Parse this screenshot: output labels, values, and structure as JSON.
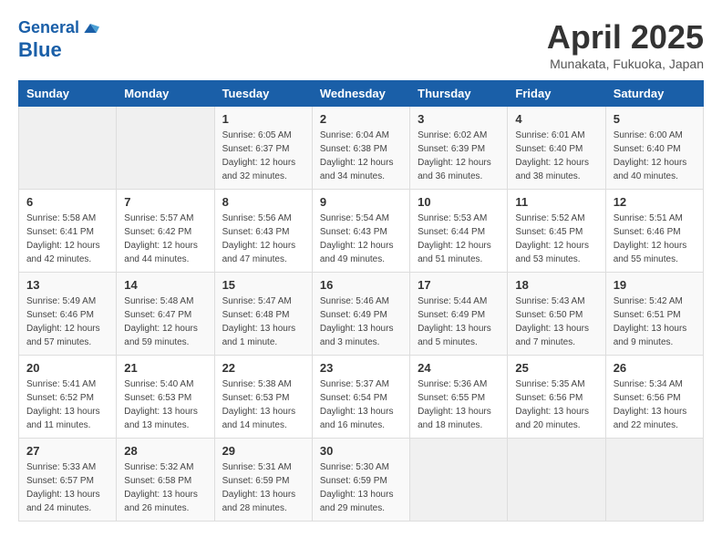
{
  "header": {
    "logo_line1": "General",
    "logo_line2": "Blue",
    "month": "April 2025",
    "location": "Munakata, Fukuoka, Japan"
  },
  "weekdays": [
    "Sunday",
    "Monday",
    "Tuesday",
    "Wednesday",
    "Thursday",
    "Friday",
    "Saturday"
  ],
  "weeks": [
    [
      {
        "day": "",
        "info": ""
      },
      {
        "day": "",
        "info": ""
      },
      {
        "day": "1",
        "sunrise": "Sunrise: 6:05 AM",
        "sunset": "Sunset: 6:37 PM",
        "daylight": "Daylight: 12 hours and 32 minutes."
      },
      {
        "day": "2",
        "sunrise": "Sunrise: 6:04 AM",
        "sunset": "Sunset: 6:38 PM",
        "daylight": "Daylight: 12 hours and 34 minutes."
      },
      {
        "day": "3",
        "sunrise": "Sunrise: 6:02 AM",
        "sunset": "Sunset: 6:39 PM",
        "daylight": "Daylight: 12 hours and 36 minutes."
      },
      {
        "day": "4",
        "sunrise": "Sunrise: 6:01 AM",
        "sunset": "Sunset: 6:40 PM",
        "daylight": "Daylight: 12 hours and 38 minutes."
      },
      {
        "day": "5",
        "sunrise": "Sunrise: 6:00 AM",
        "sunset": "Sunset: 6:40 PM",
        "daylight": "Daylight: 12 hours and 40 minutes."
      }
    ],
    [
      {
        "day": "6",
        "sunrise": "Sunrise: 5:58 AM",
        "sunset": "Sunset: 6:41 PM",
        "daylight": "Daylight: 12 hours and 42 minutes."
      },
      {
        "day": "7",
        "sunrise": "Sunrise: 5:57 AM",
        "sunset": "Sunset: 6:42 PM",
        "daylight": "Daylight: 12 hours and 44 minutes."
      },
      {
        "day": "8",
        "sunrise": "Sunrise: 5:56 AM",
        "sunset": "Sunset: 6:43 PM",
        "daylight": "Daylight: 12 hours and 47 minutes."
      },
      {
        "day": "9",
        "sunrise": "Sunrise: 5:54 AM",
        "sunset": "Sunset: 6:43 PM",
        "daylight": "Daylight: 12 hours and 49 minutes."
      },
      {
        "day": "10",
        "sunrise": "Sunrise: 5:53 AM",
        "sunset": "Sunset: 6:44 PM",
        "daylight": "Daylight: 12 hours and 51 minutes."
      },
      {
        "day": "11",
        "sunrise": "Sunrise: 5:52 AM",
        "sunset": "Sunset: 6:45 PM",
        "daylight": "Daylight: 12 hours and 53 minutes."
      },
      {
        "day": "12",
        "sunrise": "Sunrise: 5:51 AM",
        "sunset": "Sunset: 6:46 PM",
        "daylight": "Daylight: 12 hours and 55 minutes."
      }
    ],
    [
      {
        "day": "13",
        "sunrise": "Sunrise: 5:49 AM",
        "sunset": "Sunset: 6:46 PM",
        "daylight": "Daylight: 12 hours and 57 minutes."
      },
      {
        "day": "14",
        "sunrise": "Sunrise: 5:48 AM",
        "sunset": "Sunset: 6:47 PM",
        "daylight": "Daylight: 12 hours and 59 minutes."
      },
      {
        "day": "15",
        "sunrise": "Sunrise: 5:47 AM",
        "sunset": "Sunset: 6:48 PM",
        "daylight": "Daylight: 13 hours and 1 minute."
      },
      {
        "day": "16",
        "sunrise": "Sunrise: 5:46 AM",
        "sunset": "Sunset: 6:49 PM",
        "daylight": "Daylight: 13 hours and 3 minutes."
      },
      {
        "day": "17",
        "sunrise": "Sunrise: 5:44 AM",
        "sunset": "Sunset: 6:49 PM",
        "daylight": "Daylight: 13 hours and 5 minutes."
      },
      {
        "day": "18",
        "sunrise": "Sunrise: 5:43 AM",
        "sunset": "Sunset: 6:50 PM",
        "daylight": "Daylight: 13 hours and 7 minutes."
      },
      {
        "day": "19",
        "sunrise": "Sunrise: 5:42 AM",
        "sunset": "Sunset: 6:51 PM",
        "daylight": "Daylight: 13 hours and 9 minutes."
      }
    ],
    [
      {
        "day": "20",
        "sunrise": "Sunrise: 5:41 AM",
        "sunset": "Sunset: 6:52 PM",
        "daylight": "Daylight: 13 hours and 11 minutes."
      },
      {
        "day": "21",
        "sunrise": "Sunrise: 5:40 AM",
        "sunset": "Sunset: 6:53 PM",
        "daylight": "Daylight: 13 hours and 13 minutes."
      },
      {
        "day": "22",
        "sunrise": "Sunrise: 5:38 AM",
        "sunset": "Sunset: 6:53 PM",
        "daylight": "Daylight: 13 hours and 14 minutes."
      },
      {
        "day": "23",
        "sunrise": "Sunrise: 5:37 AM",
        "sunset": "Sunset: 6:54 PM",
        "daylight": "Daylight: 13 hours and 16 minutes."
      },
      {
        "day": "24",
        "sunrise": "Sunrise: 5:36 AM",
        "sunset": "Sunset: 6:55 PM",
        "daylight": "Daylight: 13 hours and 18 minutes."
      },
      {
        "day": "25",
        "sunrise": "Sunrise: 5:35 AM",
        "sunset": "Sunset: 6:56 PM",
        "daylight": "Daylight: 13 hours and 20 minutes."
      },
      {
        "day": "26",
        "sunrise": "Sunrise: 5:34 AM",
        "sunset": "Sunset: 6:56 PM",
        "daylight": "Daylight: 13 hours and 22 minutes."
      }
    ],
    [
      {
        "day": "27",
        "sunrise": "Sunrise: 5:33 AM",
        "sunset": "Sunset: 6:57 PM",
        "daylight": "Daylight: 13 hours and 24 minutes."
      },
      {
        "day": "28",
        "sunrise": "Sunrise: 5:32 AM",
        "sunset": "Sunset: 6:58 PM",
        "daylight": "Daylight: 13 hours and 26 minutes."
      },
      {
        "day": "29",
        "sunrise": "Sunrise: 5:31 AM",
        "sunset": "Sunset: 6:59 PM",
        "daylight": "Daylight: 13 hours and 28 minutes."
      },
      {
        "day": "30",
        "sunrise": "Sunrise: 5:30 AM",
        "sunset": "Sunset: 6:59 PM",
        "daylight": "Daylight: 13 hours and 29 minutes."
      },
      {
        "day": "",
        "info": ""
      },
      {
        "day": "",
        "info": ""
      },
      {
        "day": "",
        "info": ""
      }
    ]
  ]
}
